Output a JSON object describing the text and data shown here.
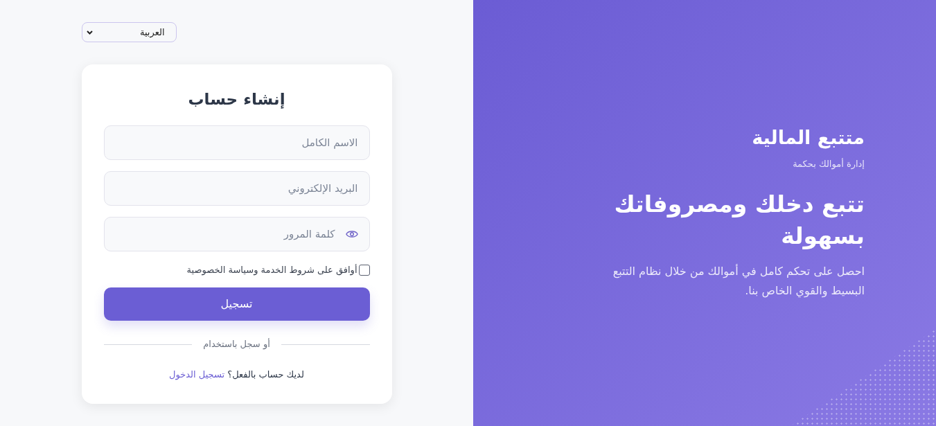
{
  "brand_panel": {
    "app_name": "متتبع المالية",
    "tagline": "إدارة أموالك بحكمة",
    "headline": "تتبع دخلك ومصروفاتك بسهولة",
    "description": "احصل على تحكم كامل في أموالك من خلال نظام التتبع البسيط والقوي الخاص بنا."
  },
  "language_select": {
    "value": "العربية"
  },
  "signup_card": {
    "title": "إنشاء حساب",
    "fields": [
      {
        "kind": "text",
        "placeholder": "الاسم الكامل"
      },
      {
        "kind": "email",
        "placeholder": "البريد الإلكتروني"
      },
      {
        "kind": "password",
        "placeholder": "كلمة المرور"
      }
    ],
    "terms_checkbox": {
      "label": "أوافق على شروط الخدمة وسياسة الخصوصية",
      "checked": false
    },
    "submit_button": "تسجيل",
    "divider_text": "أو سجل باستخدام",
    "login_prompt": {
      "text": "لديك حساب بالفعل؟",
      "link": "تسجيل الدخول"
    }
  }
}
